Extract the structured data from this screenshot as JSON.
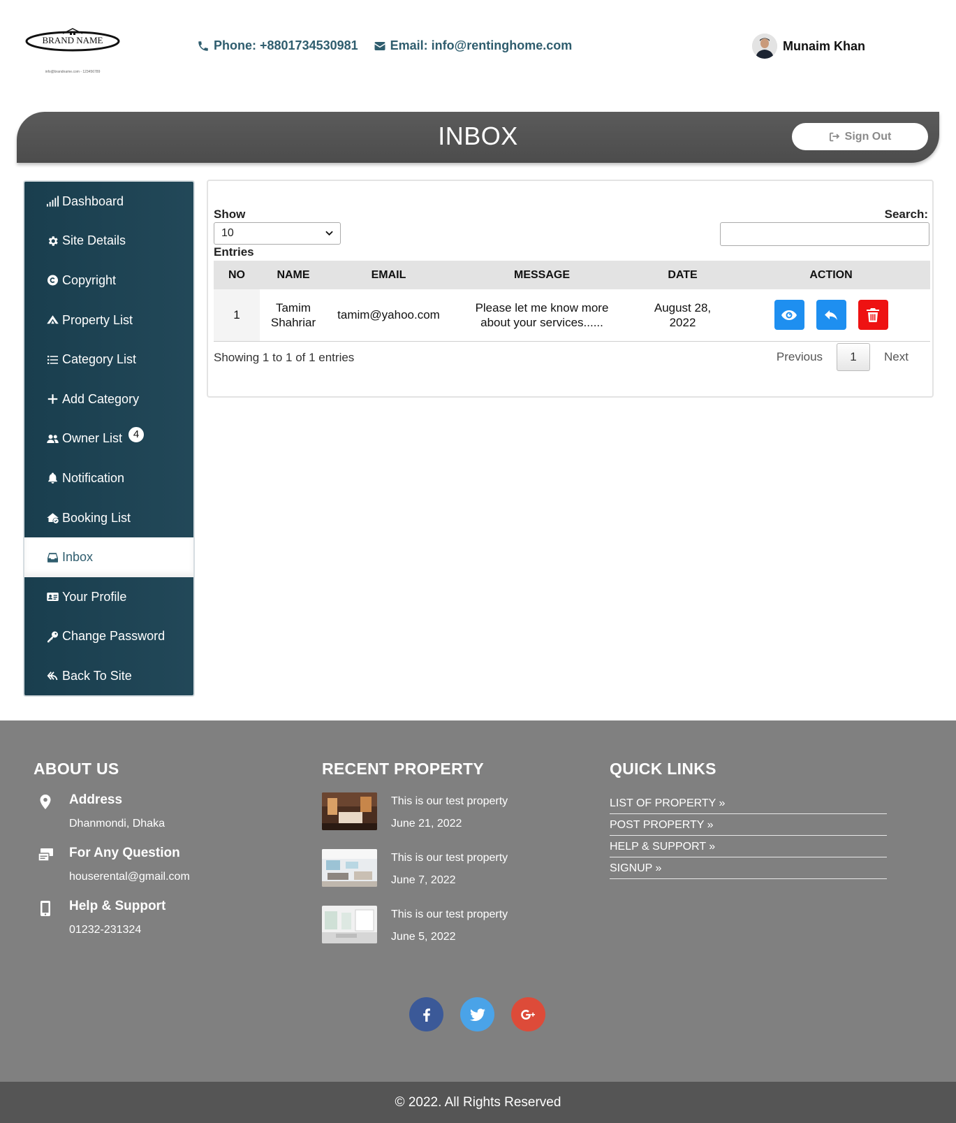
{
  "header": {
    "logo_text": "BRAND NAME",
    "logo_tagline": "info@brandname.com - 123456789",
    "phone": "Phone: +8801734530981",
    "email": "Email: info@rentinghome.com",
    "user_name": "Munaim Khan"
  },
  "titlebar": {
    "title": "INBOX",
    "signout_label": "Sign Out"
  },
  "sidebar": {
    "items": [
      {
        "label": "Dashboard",
        "icon": "signal-bars-icon"
      },
      {
        "label": "Site Details",
        "icon": "gear-icon"
      },
      {
        "label": "Copyright",
        "icon": "copyright-icon"
      },
      {
        "label": "Property List",
        "icon": "house-icon"
      },
      {
        "label": "Category List",
        "icon": "list-icon"
      },
      {
        "label": "Add Category",
        "icon": "plus-icon"
      },
      {
        "label": "Owner List",
        "icon": "users-icon",
        "badge": "4"
      },
      {
        "label": "Notification",
        "icon": "bell-icon"
      },
      {
        "label": "Booking List",
        "icon": "house-check-icon"
      },
      {
        "label": "Inbox",
        "icon": "inbox-icon",
        "active": true
      },
      {
        "label": "Your Profile",
        "icon": "id-card-icon"
      },
      {
        "label": "Change Password",
        "icon": "key-icon"
      },
      {
        "label": "Back To Site",
        "icon": "back-arrow-icon"
      }
    ]
  },
  "table_controls": {
    "show_label": "Show",
    "entries_value": "10",
    "entries_label": "Entries",
    "search_label": "Search:",
    "search_value": ""
  },
  "table": {
    "columns": [
      "NO",
      "NAME",
      "EMAIL",
      "MESSAGE",
      "DATE",
      "ACTION"
    ],
    "rows": [
      {
        "no": "1",
        "name_line1": "Tamim",
        "name_line2": "Shahriar",
        "email": "tamim@yahoo.com",
        "message_line1": "Please let me know more",
        "message_line2": "about your services......",
        "date_line1": "August 28,",
        "date_line2": "2022"
      }
    ]
  },
  "pagination": {
    "info": "Showing 1 to 1 of 1 entries",
    "previous": "Previous",
    "page": "1",
    "next": "Next"
  },
  "footer": {
    "about": {
      "heading": "ABOUT US",
      "address_title": "Address",
      "address_value": "Dhanmondi, Dhaka",
      "question_title": "For Any Question",
      "question_value": "houserental@gmail.com",
      "support_title": "Help & Support",
      "support_value": "01232-231324"
    },
    "recent": {
      "heading": "RECENT PROPERTY",
      "items": [
        {
          "title": "This is our test property",
          "date": "June 21, 2022"
        },
        {
          "title": "This is our test property",
          "date": "June 7, 2022"
        },
        {
          "title": "This is our test property",
          "date": "June 5, 2022"
        }
      ]
    },
    "quick": {
      "heading": "QUICK LINKS",
      "links": [
        "LIST OF PROPERTY »",
        "POST PROPERTY »",
        "HELP & SUPPORT »",
        "SIGNUP »"
      ]
    },
    "copyright": "© 2022. All Rights Reserved"
  },
  "colors": {
    "sidebar_bg": "#1b4253",
    "accent_text": "#2f5d6e",
    "footer_bg": "#808080",
    "copyright_bg": "#555555",
    "view_button": "#1e8ff0",
    "delete_button": "#ee1212"
  }
}
